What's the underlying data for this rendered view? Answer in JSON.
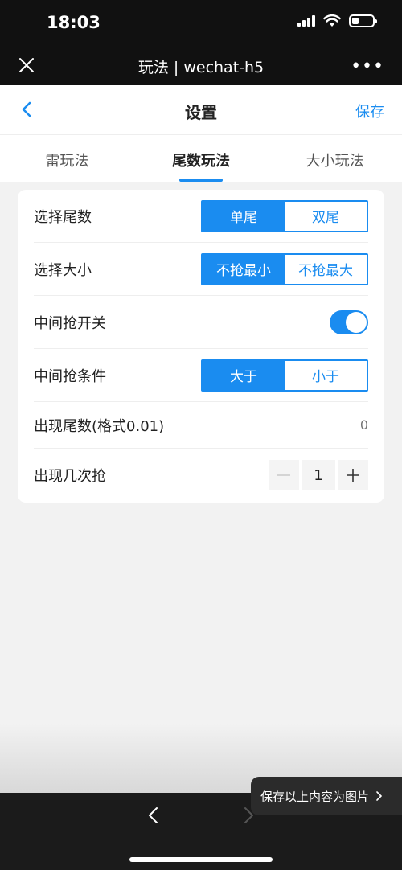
{
  "status_bar": {
    "time": "18:03"
  },
  "wechat_nav": {
    "title": "玩法 | wechat-h5",
    "more": "•••"
  },
  "header": {
    "title": "设置",
    "save_label": "保存"
  },
  "tabs": [
    {
      "label": "雷玩法",
      "active": false
    },
    {
      "label": "尾数玩法",
      "active": true
    },
    {
      "label": "大小玩法",
      "active": false
    }
  ],
  "settings": {
    "tail_select": {
      "label": "选择尾数",
      "options": [
        "单尾",
        "双尾"
      ],
      "selected": "单尾"
    },
    "size_select": {
      "label": "选择大小",
      "options": [
        "不抢最小",
        "不抢最大"
      ],
      "selected": "不抢最小"
    },
    "middle_switch": {
      "label": "中间抢开关",
      "on": true
    },
    "middle_condition": {
      "label": "中间抢条件",
      "options": [
        "大于",
        "小于"
      ],
      "selected": "大于"
    },
    "tail_appear": {
      "label": "出现尾数(格式0.01)",
      "placeholder": "0"
    },
    "times": {
      "label": "出现几次抢",
      "value": "1"
    }
  },
  "floating": {
    "save_image_label": "保存以上内容为图片"
  },
  "colors": {
    "accent": "#1a8cf0",
    "dark_bar": "#111111",
    "background": "#f2f2f2"
  }
}
